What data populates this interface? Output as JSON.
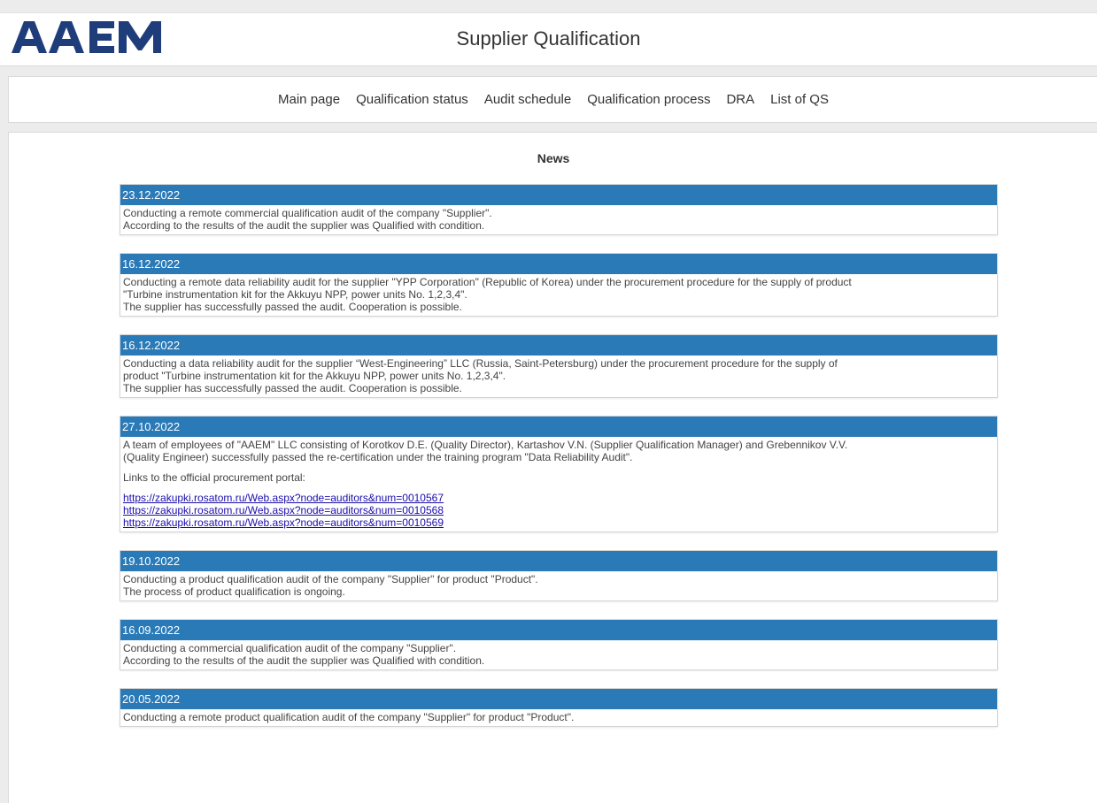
{
  "header": {
    "logo_text": "AAEM",
    "title": "Supplier Qualification"
  },
  "nav": {
    "items": [
      "Main page",
      "Qualification status",
      "Audit schedule",
      "Qualification process",
      "DRA",
      "List of QS"
    ]
  },
  "news": {
    "heading": "News",
    "items": [
      {
        "date": "23.12.2022",
        "lines": [
          "Conducting a remote commercial qualification audit of the company \"Supplier\".",
          "According to the results of the audit the supplier was Qualified with condition."
        ]
      },
      {
        "date": "16.12.2022",
        "lines": [
          "Conducting a remote data reliability audit for the supplier \"YPP Corporation\" (Republic of Korea) under the procurement procedure for the supply of product",
          "\"Turbine instrumentation kit for the Akkuyu NPP, power units No. 1,2,3,4\".",
          "The supplier has successfully passed the audit. Cooperation is possible."
        ]
      },
      {
        "date": "16.12.2022",
        "lines": [
          "Conducting a data reliability audit for the supplier “West-Engineering” LLC (Russia, Saint-Petersburg) under the procurement procedure for the supply of",
          "product \"Turbine instrumentation kit for the Akkuyu NPP, power units No. 1,2,3,4\".",
          "The supplier has successfully passed the audit. Cooperation is possible."
        ]
      },
      {
        "date": "27.10.2022",
        "lines": [
          "A team of employees of \"AAEM\" LLC consisting of Korotkov D.E. (Quality Director), Kartashov V.N. (Supplier Qualification Manager) and Grebennikov V.V.",
          "(Quality Engineer) successfully passed the re-certification under the training program \"Data Reliability Audit\"."
        ],
        "links_intro": "Links to the official procurement portal:",
        "links": [
          "https://zakupki.rosatom.ru/Web.aspx?node=auditors&num=0010567",
          "https://zakupki.rosatom.ru/Web.aspx?node=auditors&num=0010568",
          "https://zakupki.rosatom.ru/Web.aspx?node=auditors&num=0010569"
        ]
      },
      {
        "date": "19.10.2022",
        "lines": [
          "Conducting a product qualification audit of the company \"Supplier\" for product \"Product\".",
          "The process of product qualification is ongoing."
        ]
      },
      {
        "date": "16.09.2022",
        "lines": [
          "Conducting a commercial qualification audit of the company \"Supplier\".",
          "According to the results of the audit the supplier was Qualified with condition."
        ]
      },
      {
        "date": "20.05.2022",
        "lines": [
          "Conducting a remote product qualification audit of the company \"Supplier\" for product \"Product\"."
        ]
      }
    ]
  },
  "colors": {
    "accent": "#2a7ab8",
    "logo": "#1f3d7a"
  }
}
